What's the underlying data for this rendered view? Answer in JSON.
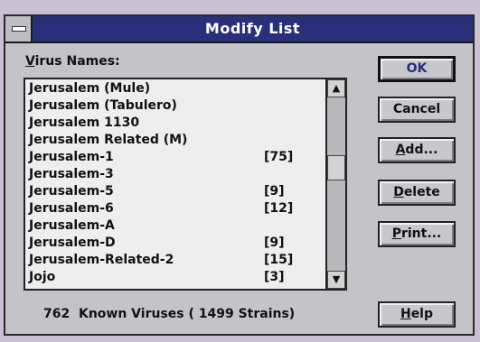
{
  "window": {
    "title": "Modify List"
  },
  "list": {
    "label_underlined": "V",
    "label_rest": "irus Names:",
    "items": [
      {
        "name": "Jerusalem (Mule)",
        "count": ""
      },
      {
        "name": "Jerusalem (Tabulero)",
        "count": ""
      },
      {
        "name": "Jerusalem 1130",
        "count": ""
      },
      {
        "name": "Jerusalem Related (M)",
        "count": ""
      },
      {
        "name": "Jerusalem-1",
        "count": "[75]"
      },
      {
        "name": "Jerusalem-3",
        "count": ""
      },
      {
        "name": "Jerusalem-5",
        "count": "[9]"
      },
      {
        "name": "Jerusalem-6",
        "count": "[12]"
      },
      {
        "name": "Jerusalem-A",
        "count": ""
      },
      {
        "name": "Jerusalem-D",
        "count": "[9]"
      },
      {
        "name": "Jerusalem-Related-2",
        "count": "[15]"
      },
      {
        "name": "Jojo",
        "count": "[3]"
      }
    ],
    "scroll_up_glyph": "▲",
    "scroll_down_glyph": "▼"
  },
  "buttons": {
    "ok": "OK",
    "cancel": "Cancel",
    "add_underlined": "A",
    "add_rest": "dd...",
    "delete_underlined": "D",
    "delete_rest": "elete",
    "print_underlined": "P",
    "print_rest": "rint...",
    "help_underlined": "H",
    "help_rest": "elp"
  },
  "status": {
    "text": "762  Known Viruses ( 1499 Strains)"
  },
  "colors": {
    "titlebar": "#2a2f7a",
    "dialog_face": "#c4c4c8",
    "list_background": "#eeeeef"
  }
}
